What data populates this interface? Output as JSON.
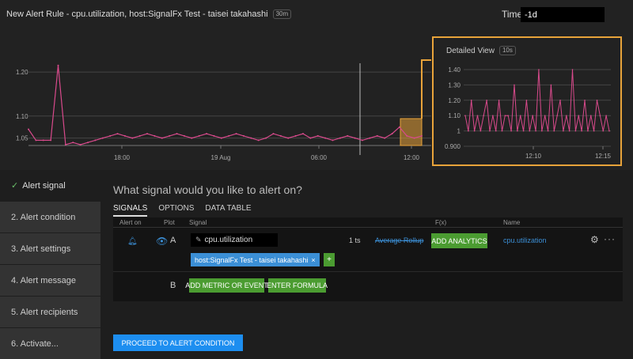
{
  "header": {
    "title": "New Alert Rule - cpu.utilization, host:SignalFx Test - taisei takahashi",
    "resolution": "30m",
    "time_label": "Time",
    "time_value": "-1d"
  },
  "main_chart": {
    "y_ticks": [
      "1.20",
      "1.10",
      "1.05"
    ],
    "x_ticks": [
      "18:00",
      "19 Aug",
      "06:00",
      "12:00"
    ],
    "series": [
      1.07,
      1.045,
      1.045,
      1.045,
      1.215,
      1.035,
      1.04,
      1.035,
      1.04,
      1.045,
      1.05,
      1.055,
      1.06,
      1.055,
      1.05,
      1.055,
      1.06,
      1.055,
      1.05,
      1.055,
      1.06,
      1.055,
      1.05,
      1.055,
      1.06,
      1.055,
      1.05,
      1.055,
      1.06,
      1.055,
      1.05,
      1.045,
      1.05,
      1.06,
      1.055,
      1.05,
      1.055,
      1.06,
      1.05,
      1.055,
      1.05,
      1.045,
      1.05,
      1.055,
      1.05,
      1.045,
      1.05,
      1.055,
      1.05,
      1.06,
      1.075,
      1.055,
      1.05,
      1.055
    ]
  },
  "detail_chart": {
    "title": "Detailed View",
    "resolution": "10s",
    "y_ticks": [
      "1.40",
      "1.30",
      "1.20",
      "1.10",
      "1",
      "0.900"
    ],
    "x_ticks": [
      "12:10",
      "12:15"
    ],
    "series": [
      1.1,
      1.0,
      1.2,
      1.0,
      1.1,
      1.0,
      1.1,
      1.2,
      1.0,
      1.1,
      1.0,
      1.2,
      1.0,
      1.1,
      1.1,
      1.0,
      1.3,
      1.0,
      1.1,
      1.0,
      1.2,
      1.0,
      1.1,
      1.0,
      1.4,
      1.0,
      1.1,
      1.0,
      1.3,
      1.0,
      1.1,
      1.2,
      1.0,
      1.1,
      1.0,
      1.4,
      1.0,
      1.1,
      1.0,
      1.2,
      1.0,
      1.1,
      1.0,
      1.2,
      1.1,
      1.0,
      1.1,
      1.0
    ]
  },
  "sidebar": {
    "items": [
      {
        "label": "Alert signal"
      },
      {
        "label": "2.  Alert condition"
      },
      {
        "label": "3.  Alert settings"
      },
      {
        "label": "4.  Alert message"
      },
      {
        "label": "5.  Alert recipients"
      },
      {
        "label": "6.  Activate..."
      }
    ]
  },
  "main": {
    "question": "What signal would you like to alert on?",
    "tabs": [
      "SIGNALS",
      "OPTIONS",
      "DATA TABLE"
    ],
    "columns": [
      "Alert on",
      "Plot",
      "Signal",
      "F(x)",
      "Name"
    ],
    "row1": {
      "letter": "A",
      "metric": "cpu.utilization",
      "filter": "host:SignalFx Test - taisei takahashi",
      "filter_close": "×",
      "plus": "+",
      "ts_count": "1 ts",
      "rollup": "Average Rollup",
      "analytics_btn": "ADD ANALYTICS",
      "name": "cpu.utilization",
      "more": "···"
    },
    "row2": {
      "letter": "B",
      "add_metric_btn": "ADD METRIC OR EVENT",
      "formula_btn": "ENTER FORMULA"
    },
    "proceed_btn": "PROCEED TO ALERT CONDITION"
  },
  "colors": {
    "series": "#d94a8c",
    "highlight": "#e8a33a",
    "link": "#3b8fd6",
    "button_green": "#4b9c31",
    "button_blue": "#1d8ef0"
  }
}
